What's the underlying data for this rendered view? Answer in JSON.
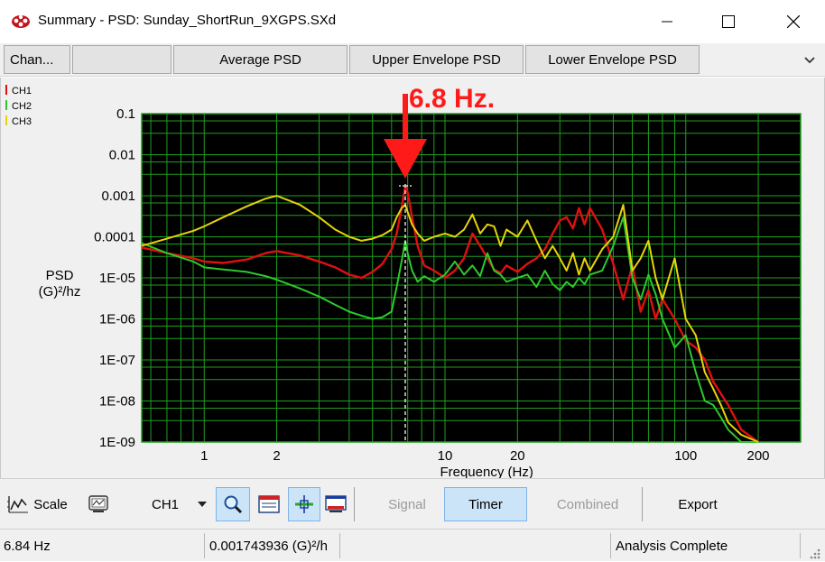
{
  "window": {
    "title": "Summary - PSD: Sunday_ShortRun_9XGPS.SXd",
    "buttons": [
      "minimize",
      "maximize",
      "close"
    ]
  },
  "tabs": [
    {
      "label": "Chan..."
    },
    {
      "label": ""
    },
    {
      "label": "Average PSD"
    },
    {
      "label": "Upper Envelope PSD"
    },
    {
      "label": "Lower Envelope PSD"
    }
  ],
  "annotation": {
    "text": "6.8 Hz.",
    "color": "#ff1a1a"
  },
  "chart_data": {
    "type": "line",
    "title": "",
    "xlabel": "Frequency (Hz)",
    "ylabel": "PSD\n(G)²/hz",
    "xscale": "log",
    "yscale": "log",
    "xlim": [
      0.55,
      300
    ],
    "ylim": [
      1e-09,
      0.1
    ],
    "x_ticks": [
      1,
      2,
      10,
      20,
      100,
      200
    ],
    "x_tick_labels": [
      "1",
      "2",
      "10",
      "20",
      "100",
      "200"
    ],
    "y_ticks": [
      0.1,
      0.01,
      0.001,
      0.0001,
      1e-05,
      1e-06,
      1e-07,
      1e-08,
      1e-09
    ],
    "y_tick_labels": [
      "0.1",
      "0.01",
      "0.001",
      "0.0001",
      "1E-05",
      "1E-06",
      "1E-07",
      "1E-08",
      "1E-09"
    ],
    "grid": true,
    "background": "#000000",
    "grid_color": "#1f9e1f",
    "legend_position": "top-left",
    "cursor_x": 6.84,
    "series": [
      {
        "name": "CH1",
        "color": "#e01010",
        "x": [
          0.55,
          0.7,
          0.9,
          1.0,
          1.2,
          1.5,
          1.8,
          2.0,
          2.5,
          3.0,
          3.5,
          4.0,
          4.5,
          5.0,
          5.5,
          6.0,
          6.3,
          6.6,
          6.84,
          7.0,
          7.3,
          7.7,
          8.2,
          9.0,
          10.0,
          11.0,
          12.0,
          13.0,
          14.0,
          15.0,
          16.0,
          17.0,
          18.0,
          20.0,
          22.0,
          24.0,
          26.0,
          28.0,
          30.0,
          32.0,
          34.0,
          36.0,
          38.0,
          40.0,
          45.0,
          50.0,
          55.0,
          60.0,
          65.0,
          70.0,
          75.0,
          80.0,
          90.0,
          100.0,
          110.0,
          120.0,
          130.0,
          140.0,
          150.0,
          170.0,
          200.0
        ],
        "y": [
          5.5e-05,
          4e-05,
          3e-05,
          2.5e-05,
          2.3e-05,
          2.8e-05,
          4e-05,
          4.5e-05,
          3.5e-05,
          2.5e-05,
          1.8e-05,
          1.2e-05,
          1e-05,
          1.4e-05,
          2.2e-05,
          5e-05,
          0.00012,
          0.0005,
          0.00174,
          0.0012,
          0.0003,
          6e-05,
          2e-05,
          1.5e-05,
          1e-05,
          1.5e-05,
          3e-05,
          0.00012,
          6e-05,
          3e-05,
          1.6e-05,
          1.3e-05,
          2e-05,
          1.4e-05,
          2.2e-05,
          3e-05,
          5e-05,
          0.00012,
          0.00025,
          0.0003,
          0.00016,
          0.0005,
          0.0002,
          0.0005,
          0.00015,
          2.2e-05,
          3e-06,
          2e-05,
          1.5e-06,
          5e-06,
          1e-06,
          3e-06,
          1e-06,
          3e-07,
          2e-07,
          1e-07,
          3e-08,
          1.5e-08,
          8e-09,
          2e-09,
          1e-09
        ]
      },
      {
        "name": "CH2",
        "color": "#2ec82e",
        "x": [
          0.55,
          0.7,
          0.9,
          1.0,
          1.2,
          1.5,
          1.8,
          2.0,
          2.5,
          3.0,
          3.5,
          4.0,
          4.5,
          5.0,
          5.5,
          6.0,
          6.3,
          6.6,
          6.84,
          7.0,
          7.3,
          7.7,
          8.2,
          9.0,
          10.0,
          11.0,
          12.0,
          13.0,
          14.0,
          15.0,
          16.0,
          17.0,
          18.0,
          20.0,
          22.0,
          24.0,
          26.0,
          28.0,
          30.0,
          32.0,
          34.0,
          36.0,
          38.0,
          40.0,
          45.0,
          50.0,
          55.0,
          60.0,
          65.0,
          70.0,
          75.0,
          80.0,
          90.0,
          100.0,
          110.0,
          120.0,
          130.0,
          140.0,
          150.0,
          170.0,
          200.0
        ],
        "y": [
          7e-05,
          4e-05,
          2.5e-05,
          1.8e-05,
          1.6e-05,
          1.4e-05,
          1.1e-05,
          9e-06,
          5.5e-06,
          3.5e-06,
          2.2e-06,
          1.5e-06,
          1.2e-06,
          1e-06,
          1.1e-06,
          1.5e-06,
          6e-06,
          2.5e-05,
          8e-05,
          4e-05,
          1.5e-05,
          8e-06,
          1.1e-05,
          8e-06,
          1.2e-05,
          2.5e-05,
          1.2e-05,
          2e-05,
          1.1e-05,
          4e-05,
          1.5e-05,
          1.2e-05,
          8e-06,
          1e-05,
          1.2e-05,
          6e-06,
          1.5e-05,
          7e-06,
          5e-06,
          8e-06,
          6e-06,
          1e-05,
          7e-06,
          1.2e-05,
          1.5e-05,
          6e-05,
          0.0003,
          1e-05,
          3e-06,
          1.2e-05,
          4e-06,
          1e-06,
          2e-07,
          4e-07,
          5e-08,
          1e-08,
          8e-09,
          4e-09,
          2e-09,
          1e-09,
          1e-09
        ]
      },
      {
        "name": "CH3",
        "color": "#e6d40a",
        "x": [
          0.55,
          0.7,
          0.9,
          1.0,
          1.2,
          1.5,
          1.8,
          2.0,
          2.5,
          3.0,
          3.5,
          4.0,
          4.5,
          5.0,
          5.5,
          6.0,
          6.3,
          6.6,
          6.84,
          7.0,
          7.3,
          7.7,
          8.2,
          9.0,
          10.0,
          11.0,
          12.0,
          13.0,
          14.0,
          15.0,
          16.0,
          17.0,
          18.0,
          20.0,
          22.0,
          24.0,
          26.0,
          28.0,
          30.0,
          32.0,
          34.0,
          36.0,
          38.0,
          40.0,
          45.0,
          50.0,
          55.0,
          60.0,
          65.0,
          70.0,
          75.0,
          80.0,
          90.0,
          100.0,
          110.0,
          120.0,
          130.0,
          140.0,
          150.0,
          170.0,
          200.0
        ],
        "y": [
          6e-05,
          9e-05,
          0.00014,
          0.00018,
          0.0003,
          0.00055,
          0.00085,
          0.001,
          0.0006,
          0.0003,
          0.00015,
          0.0001,
          8e-05,
          9e-05,
          0.00011,
          0.00015,
          0.0003,
          0.0005,
          0.0006,
          0.0004,
          0.0002,
          0.00012,
          8e-05,
          0.0001,
          0.00012,
          0.0001,
          0.00015,
          0.00035,
          0.00012,
          0.0002,
          0.00018,
          6e-05,
          0.00015,
          0.0001,
          0.00025,
          8e-05,
          3e-05,
          6e-05,
          3e-05,
          1.5e-05,
          4e-05,
          1.2e-05,
          3e-05,
          1.5e-05,
          5e-05,
          0.0001,
          0.0006,
          1.5e-05,
          3e-05,
          8e-05,
          1e-05,
          3e-06,
          3e-05,
          1e-06,
          4e-07,
          5e-08,
          2e-08,
          8e-09,
          3e-09,
          1.5e-09,
          1e-09
        ]
      }
    ]
  },
  "toolbar": {
    "scale_label": "Scale",
    "channel_value": "CH1",
    "signal_label": "Signal",
    "timer_label": "Timer",
    "combined_label": "Combined",
    "export_label": "Export"
  },
  "status": {
    "frequency": "6.84 Hz",
    "psd_value": "0.001743936 (G)²/h",
    "empty": "",
    "state": "Analysis Complete"
  }
}
